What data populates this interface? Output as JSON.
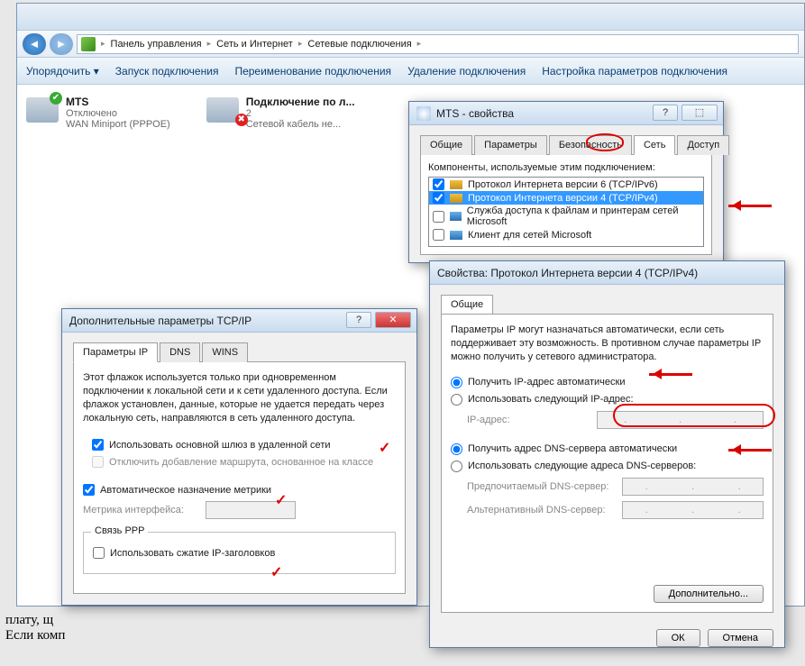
{
  "breadcrumbs": {
    "a": "Панель управления",
    "b": "Сеть и Интернет",
    "c": "Сетевые подключения"
  },
  "toolbar": {
    "organize": "Упорядочить",
    "start": "Запуск подключения",
    "rename": "Переименование подключения",
    "delete": "Удаление подключения",
    "settings": "Настройка параметров подключения"
  },
  "conn1": {
    "name": "MTS",
    "status": "Отключено",
    "device": "WAN Miniport (PPPOE)"
  },
  "conn2": {
    "name": "Подключение по л...",
    "line2": "2",
    "status": "Сетевой кабель не..."
  },
  "mts": {
    "title": "MTS - свойства",
    "tabs": {
      "general": "Общие",
      "params": "Параметры",
      "security": "Безопасность",
      "net": "Сеть",
      "access": "Доступ"
    },
    "components_label": "Компоненты, используемые этим подключением:",
    "items": {
      "ipv6": "Протокол Интернета версии 6 (TCP/IPv6)",
      "ipv4": "Протокол Интернета версии 4 (TCP/IPv4)",
      "fileshare": "Служба доступа к файлам и принтерам сетей Microsoft",
      "client": "Клиент для сетей Microsoft"
    }
  },
  "ipv4": {
    "title": "Свойства: Протокол Интернета версии 4 (TCP/IPv4)",
    "tab": "Общие",
    "intro": "Параметры IP могут назначаться автоматически, если сеть поддерживает эту возможность. В противном случае параметры IP можно получить у сетевого администратора.",
    "auto_ip": "Получить IP-адрес автоматически",
    "manual_ip": "Использовать следующий IP-адрес:",
    "ip_label": "IP-адрес:",
    "auto_dns": "Получить адрес DNS-сервера автоматически",
    "manual_dns": "Использовать следующие адреса DNS-серверов:",
    "dns1": "Предпочитаемый DNS-сервер:",
    "dns2": "Альтернативный DNS-сервер:",
    "advanced_btn": "Дополнительно...",
    "ok": "ОК",
    "cancel": "Отмена"
  },
  "adv": {
    "title": "Дополнительные параметры TCP/IP",
    "tabs": {
      "ip": "Параметры IP",
      "dns": "DNS",
      "wins": "WINS"
    },
    "intro": "Этот флажок используется только при одновременном подключении к локальной сети и к сети удаленного доступа. Если флажок установлен, данные, которые не удается передать через локальную сеть, направляются в сеть удаленного доступа.",
    "gateway": "Использовать основной шлюз в удаленной сети",
    "route": "Отключить добавление маршрута, основанное на классе",
    "metric_auto": "Автоматическое назначение метрики",
    "metric_label": "Метрика интерфейса:",
    "ppp_group": "Связь PPP",
    "ppp_compress": "Использовать сжатие IP-заголовков"
  },
  "bg_text": {
    "a": "плату, щ",
    "b": "Если комп"
  }
}
